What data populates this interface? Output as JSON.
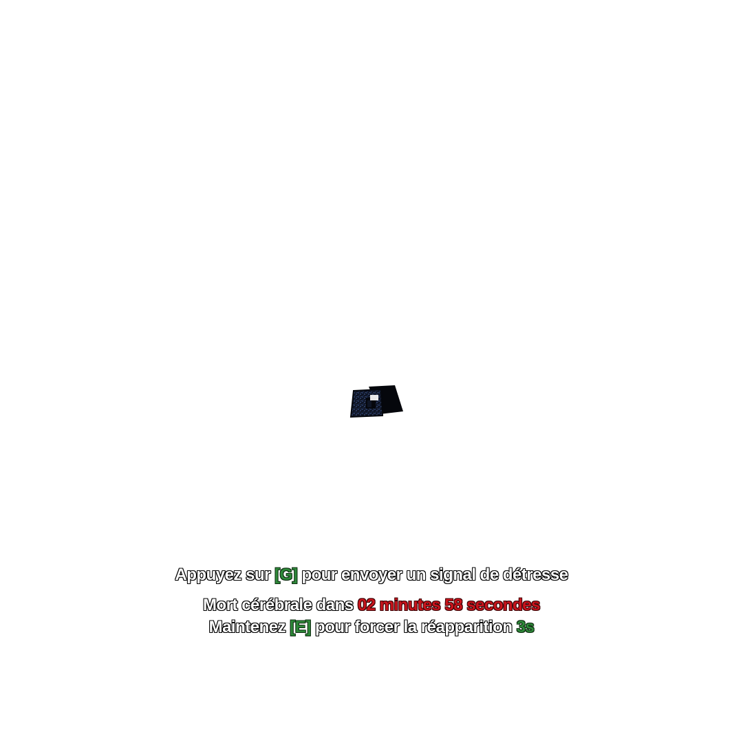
{
  "logo": {
    "icon": "distress-logo-icon",
    "color_dark": "#0e1424",
    "color_speckle": "#3b5a9a"
  },
  "hud": {
    "distress": {
      "prefix": "Appuyez sur ",
      "key": "[G]",
      "suffix": " pour envoyer un signal de détresse"
    },
    "brain_death": {
      "prefix": "Mort cérébrale dans ",
      "countdown": "02 minutes 58 secondes"
    },
    "respawn": {
      "prefix": "Maintenez ",
      "key": "[E]",
      "middle": " pour forcer la réapparition ",
      "timer": "3s"
    }
  },
  "colors": {
    "text": "#ffffff",
    "key": "#2f8a3a",
    "countdown": "#c8141c",
    "timer": "#2f8a3a"
  }
}
